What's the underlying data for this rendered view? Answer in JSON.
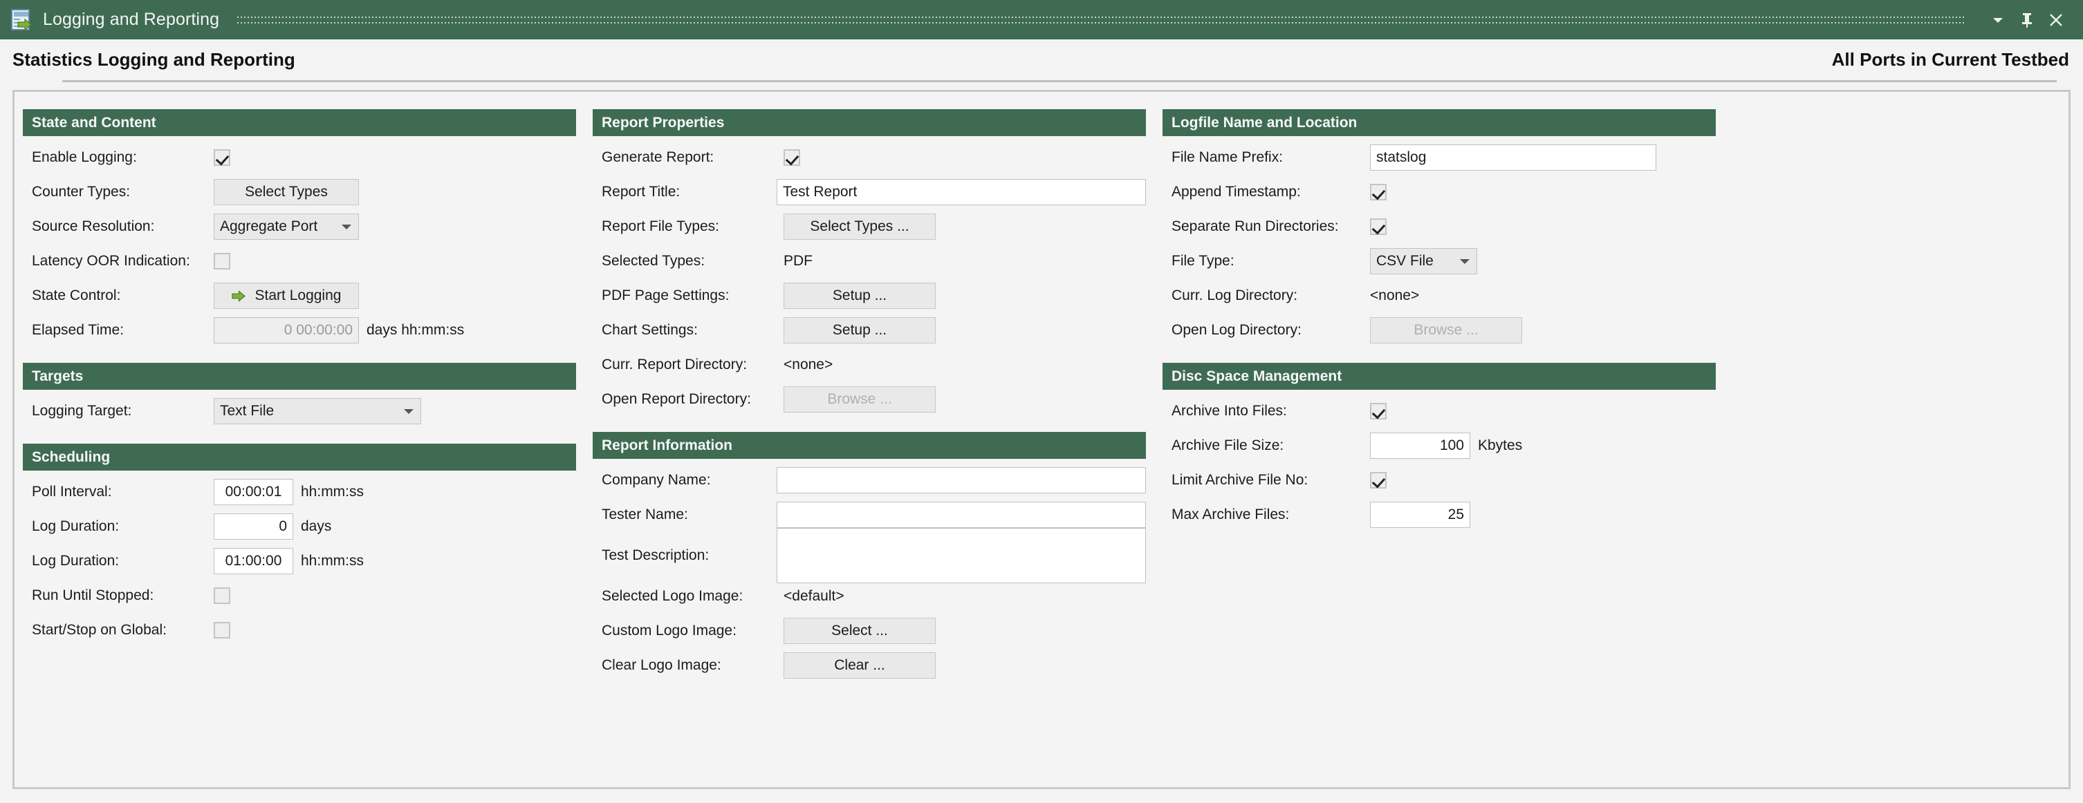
{
  "window": {
    "title": "Logging and Reporting",
    "icon": "report-log-icon",
    "buttons": [
      {
        "name": "window-menu-button",
        "glyph": "▼"
      },
      {
        "name": "pin-button",
        "glyph": "📌"
      },
      {
        "name": "close-button",
        "glyph": "✕"
      }
    ]
  },
  "header": {
    "title": "Statistics Logging and Reporting",
    "scope": "All Ports in Current Testbed"
  },
  "colors": {
    "accent": "#3f6b53",
    "panel_bg": "#f4f4f4",
    "button_bg": "#e9e9e9",
    "arrow_green": "#7db23a"
  },
  "columns": {
    "left": {
      "state_and_content": {
        "title": "State and Content",
        "enable_logging_label": "Enable Logging:",
        "enable_logging_checked": true,
        "counter_types_label": "Counter Types:",
        "counter_types_button": "Select Types",
        "source_resolution_label": "Source Resolution:",
        "source_resolution_value": "Aggregate Port",
        "latency_oor_label": "Latency OOR Indication:",
        "latency_oor_checked": false,
        "state_control_label": "State Control:",
        "state_control_button": "Start Logging",
        "elapsed_time_label": "Elapsed Time:",
        "elapsed_time_value": "0 00:00:00",
        "elapsed_time_suffix": "days hh:mm:ss"
      },
      "targets": {
        "title": "Targets",
        "logging_target_label": "Logging Target:",
        "logging_target_value": "Text File"
      },
      "scheduling": {
        "title": "Scheduling",
        "poll_interval_label": "Poll Interval:",
        "poll_interval_value": "00:00:01",
        "poll_interval_suffix": "hh:mm:ss",
        "log_duration_days_label": "Log Duration:",
        "log_duration_days_value": "0",
        "log_duration_days_suffix": "days",
        "log_duration_time_label": "Log Duration:",
        "log_duration_time_value": "01:00:00",
        "log_duration_time_suffix": "hh:mm:ss",
        "run_until_stopped_label": "Run Until Stopped:",
        "run_until_stopped_checked": false,
        "start_stop_global_label": "Start/Stop on Global:",
        "start_stop_global_checked": false
      }
    },
    "middle": {
      "report_properties": {
        "title": "Report Properties",
        "generate_report_label": "Generate Report:",
        "generate_report_checked": true,
        "report_title_label": "Report Title:",
        "report_title_value": "Test Report",
        "report_file_types_label": "Report File Types:",
        "report_file_types_button": "Select Types ...",
        "selected_types_label": "Selected Types:",
        "selected_types_value": "PDF",
        "pdf_page_settings_label": "PDF Page Settings:",
        "pdf_page_settings_button": "Setup ...",
        "chart_settings_label": "Chart Settings:",
        "chart_settings_button": "Setup ...",
        "curr_report_dir_label": "Curr. Report Directory:",
        "curr_report_dir_value": "<none>",
        "open_report_dir_label": "Open Report Directory:",
        "open_report_dir_button": "Browse ..."
      },
      "report_information": {
        "title": "Report Information",
        "company_name_label": "Company Name:",
        "company_name_value": "",
        "tester_name_label": "Tester Name:",
        "tester_name_value": "",
        "test_description_label": "Test Description:",
        "test_description_value": "",
        "selected_logo_label": "Selected Logo Image:",
        "selected_logo_value": "<default>",
        "custom_logo_label": "Custom Logo Image:",
        "custom_logo_button": "Select ...",
        "clear_logo_label": "Clear Logo Image:",
        "clear_logo_button": "Clear ..."
      }
    },
    "right": {
      "logfile_name_location": {
        "title": "Logfile Name and Location",
        "file_name_prefix_label": "File Name Prefix:",
        "file_name_prefix_value": "statslog",
        "append_timestamp_label": "Append Timestamp:",
        "append_timestamp_checked": true,
        "separate_run_dirs_label": "Separate Run Directories:",
        "separate_run_dirs_checked": true,
        "file_type_label": "File Type:",
        "file_type_value": "CSV File",
        "curr_log_dir_label": "Curr. Log Directory:",
        "curr_log_dir_value": "<none>",
        "open_log_dir_label": "Open Log Directory:",
        "open_log_dir_button": "Browse ..."
      },
      "disc_space_management": {
        "title": "Disc Space Management",
        "archive_into_files_label": "Archive Into Files:",
        "archive_into_files_checked": true,
        "archive_file_size_label": "Archive File Size:",
        "archive_file_size_value": "100",
        "archive_file_size_suffix": "Kbytes",
        "limit_archive_file_no_label": "Limit Archive File No:",
        "limit_archive_file_no_checked": true,
        "max_archive_files_label": "Max Archive Files:",
        "max_archive_files_value": "25"
      }
    }
  }
}
